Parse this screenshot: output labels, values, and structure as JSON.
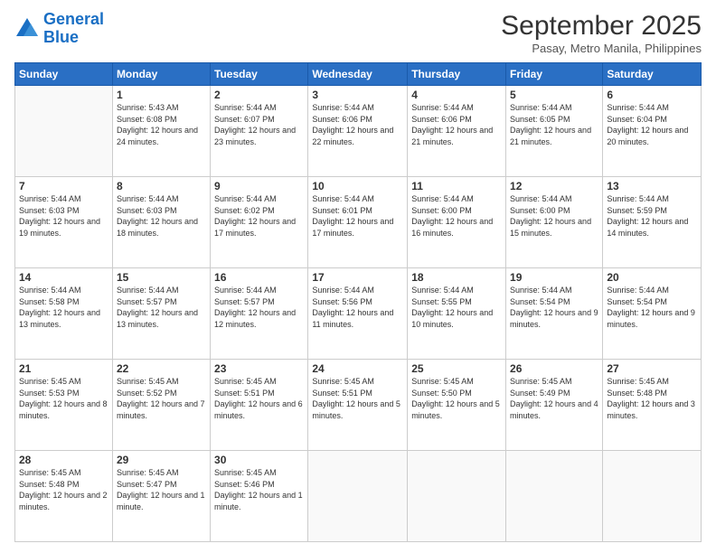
{
  "logo": {
    "line1": "General",
    "line2": "Blue"
  },
  "header": {
    "title": "September 2025",
    "location": "Pasay, Metro Manila, Philippines"
  },
  "weekdays": [
    "Sunday",
    "Monday",
    "Tuesday",
    "Wednesday",
    "Thursday",
    "Friday",
    "Saturday"
  ],
  "weeks": [
    [
      {
        "day": "",
        "sunrise": "",
        "sunset": "",
        "daylight": ""
      },
      {
        "day": "1",
        "sunrise": "Sunrise: 5:43 AM",
        "sunset": "Sunset: 6:08 PM",
        "daylight": "Daylight: 12 hours and 24 minutes."
      },
      {
        "day": "2",
        "sunrise": "Sunrise: 5:44 AM",
        "sunset": "Sunset: 6:07 PM",
        "daylight": "Daylight: 12 hours and 23 minutes."
      },
      {
        "day": "3",
        "sunrise": "Sunrise: 5:44 AM",
        "sunset": "Sunset: 6:06 PM",
        "daylight": "Daylight: 12 hours and 22 minutes."
      },
      {
        "day": "4",
        "sunrise": "Sunrise: 5:44 AM",
        "sunset": "Sunset: 6:06 PM",
        "daylight": "Daylight: 12 hours and 21 minutes."
      },
      {
        "day": "5",
        "sunrise": "Sunrise: 5:44 AM",
        "sunset": "Sunset: 6:05 PM",
        "daylight": "Daylight: 12 hours and 21 minutes."
      },
      {
        "day": "6",
        "sunrise": "Sunrise: 5:44 AM",
        "sunset": "Sunset: 6:04 PM",
        "daylight": "Daylight: 12 hours and 20 minutes."
      }
    ],
    [
      {
        "day": "7",
        "sunrise": "Sunrise: 5:44 AM",
        "sunset": "Sunset: 6:03 PM",
        "daylight": "Daylight: 12 hours and 19 minutes."
      },
      {
        "day": "8",
        "sunrise": "Sunrise: 5:44 AM",
        "sunset": "Sunset: 6:03 PM",
        "daylight": "Daylight: 12 hours and 18 minutes."
      },
      {
        "day": "9",
        "sunrise": "Sunrise: 5:44 AM",
        "sunset": "Sunset: 6:02 PM",
        "daylight": "Daylight: 12 hours and 17 minutes."
      },
      {
        "day": "10",
        "sunrise": "Sunrise: 5:44 AM",
        "sunset": "Sunset: 6:01 PM",
        "daylight": "Daylight: 12 hours and 17 minutes."
      },
      {
        "day": "11",
        "sunrise": "Sunrise: 5:44 AM",
        "sunset": "Sunset: 6:00 PM",
        "daylight": "Daylight: 12 hours and 16 minutes."
      },
      {
        "day": "12",
        "sunrise": "Sunrise: 5:44 AM",
        "sunset": "Sunset: 6:00 PM",
        "daylight": "Daylight: 12 hours and 15 minutes."
      },
      {
        "day": "13",
        "sunrise": "Sunrise: 5:44 AM",
        "sunset": "Sunset: 5:59 PM",
        "daylight": "Daylight: 12 hours and 14 minutes."
      }
    ],
    [
      {
        "day": "14",
        "sunrise": "Sunrise: 5:44 AM",
        "sunset": "Sunset: 5:58 PM",
        "daylight": "Daylight: 12 hours and 13 minutes."
      },
      {
        "day": "15",
        "sunrise": "Sunrise: 5:44 AM",
        "sunset": "Sunset: 5:57 PM",
        "daylight": "Daylight: 12 hours and 13 minutes."
      },
      {
        "day": "16",
        "sunrise": "Sunrise: 5:44 AM",
        "sunset": "Sunset: 5:57 PM",
        "daylight": "Daylight: 12 hours and 12 minutes."
      },
      {
        "day": "17",
        "sunrise": "Sunrise: 5:44 AM",
        "sunset": "Sunset: 5:56 PM",
        "daylight": "Daylight: 12 hours and 11 minutes."
      },
      {
        "day": "18",
        "sunrise": "Sunrise: 5:44 AM",
        "sunset": "Sunset: 5:55 PM",
        "daylight": "Daylight: 12 hours and 10 minutes."
      },
      {
        "day": "19",
        "sunrise": "Sunrise: 5:44 AM",
        "sunset": "Sunset: 5:54 PM",
        "daylight": "Daylight: 12 hours and 9 minutes."
      },
      {
        "day": "20",
        "sunrise": "Sunrise: 5:44 AM",
        "sunset": "Sunset: 5:54 PM",
        "daylight": "Daylight: 12 hours and 9 minutes."
      }
    ],
    [
      {
        "day": "21",
        "sunrise": "Sunrise: 5:45 AM",
        "sunset": "Sunset: 5:53 PM",
        "daylight": "Daylight: 12 hours and 8 minutes."
      },
      {
        "day": "22",
        "sunrise": "Sunrise: 5:45 AM",
        "sunset": "Sunset: 5:52 PM",
        "daylight": "Daylight: 12 hours and 7 minutes."
      },
      {
        "day": "23",
        "sunrise": "Sunrise: 5:45 AM",
        "sunset": "Sunset: 5:51 PM",
        "daylight": "Daylight: 12 hours and 6 minutes."
      },
      {
        "day": "24",
        "sunrise": "Sunrise: 5:45 AM",
        "sunset": "Sunset: 5:51 PM",
        "daylight": "Daylight: 12 hours and 5 minutes."
      },
      {
        "day": "25",
        "sunrise": "Sunrise: 5:45 AM",
        "sunset": "Sunset: 5:50 PM",
        "daylight": "Daylight: 12 hours and 5 minutes."
      },
      {
        "day": "26",
        "sunrise": "Sunrise: 5:45 AM",
        "sunset": "Sunset: 5:49 PM",
        "daylight": "Daylight: 12 hours and 4 minutes."
      },
      {
        "day": "27",
        "sunrise": "Sunrise: 5:45 AM",
        "sunset": "Sunset: 5:48 PM",
        "daylight": "Daylight: 12 hours and 3 minutes."
      }
    ],
    [
      {
        "day": "28",
        "sunrise": "Sunrise: 5:45 AM",
        "sunset": "Sunset: 5:48 PM",
        "daylight": "Daylight: 12 hours and 2 minutes."
      },
      {
        "day": "29",
        "sunrise": "Sunrise: 5:45 AM",
        "sunset": "Sunset: 5:47 PM",
        "daylight": "Daylight: 12 hours and 1 minute."
      },
      {
        "day": "30",
        "sunrise": "Sunrise: 5:45 AM",
        "sunset": "Sunset: 5:46 PM",
        "daylight": "Daylight: 12 hours and 1 minute."
      },
      {
        "day": "",
        "sunrise": "",
        "sunset": "",
        "daylight": ""
      },
      {
        "day": "",
        "sunrise": "",
        "sunset": "",
        "daylight": ""
      },
      {
        "day": "",
        "sunrise": "",
        "sunset": "",
        "daylight": ""
      },
      {
        "day": "",
        "sunrise": "",
        "sunset": "",
        "daylight": ""
      }
    ]
  ]
}
